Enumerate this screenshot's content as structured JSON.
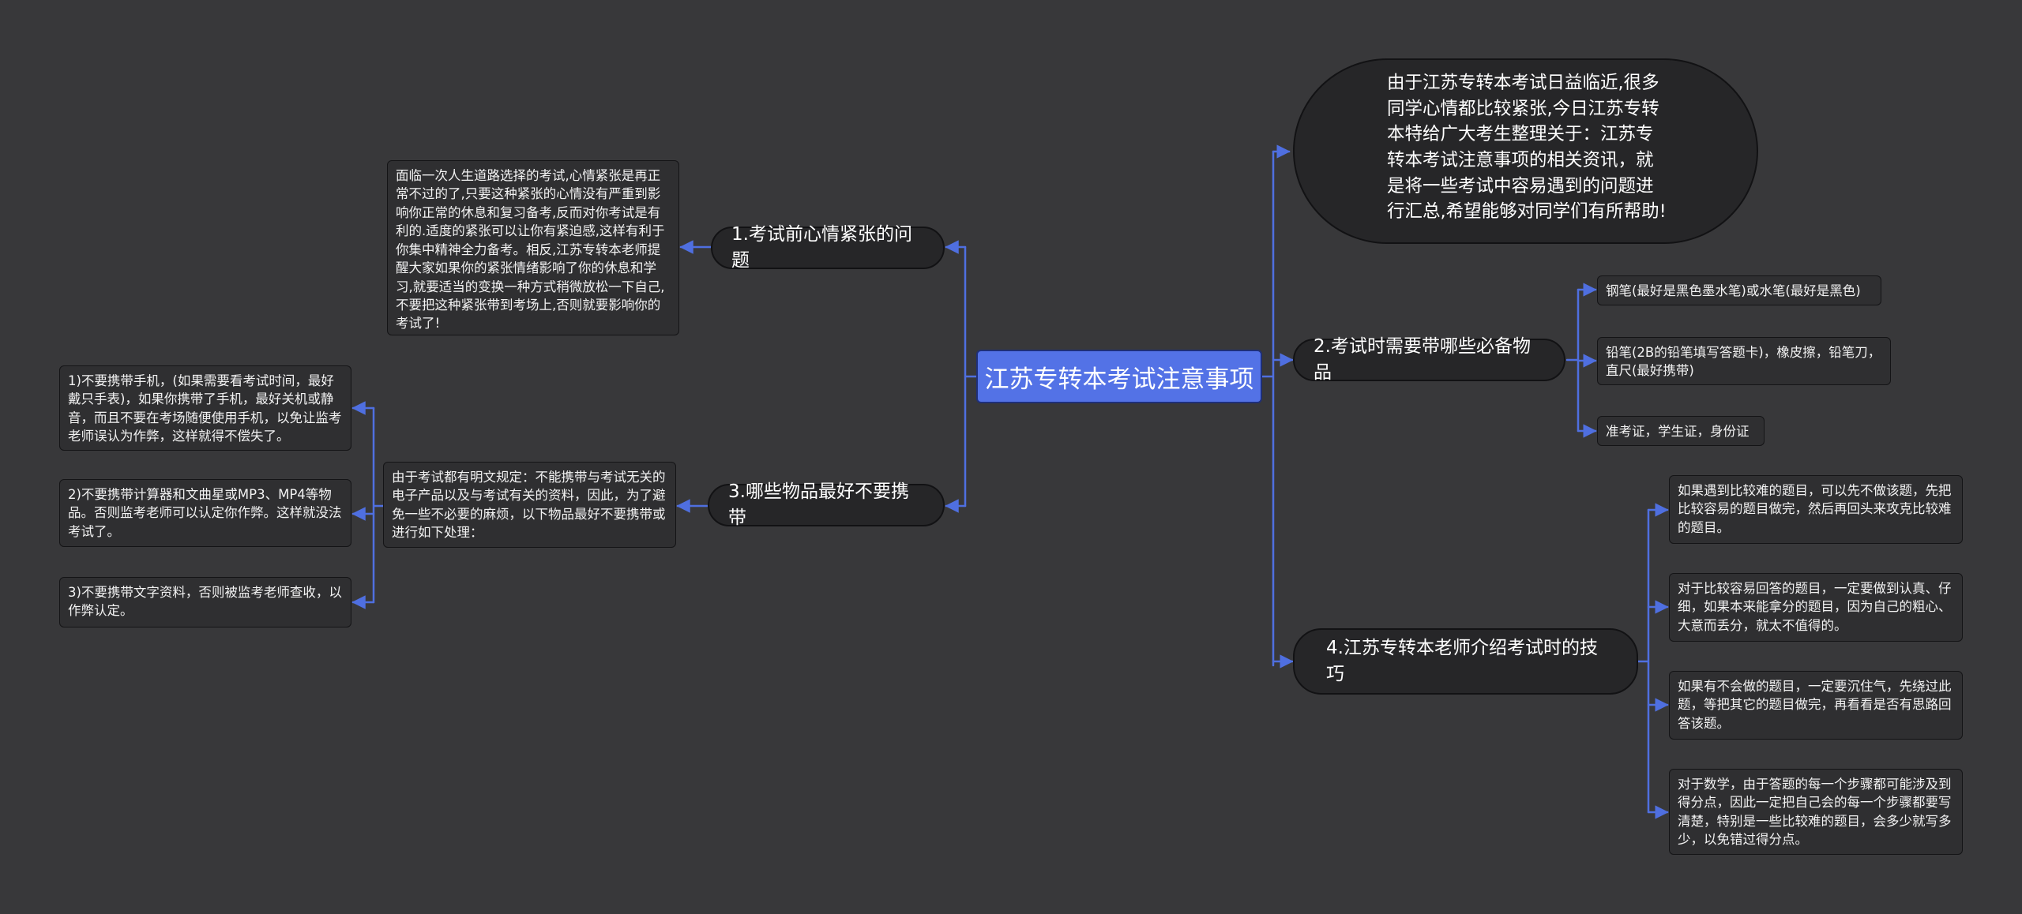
{
  "root": {
    "label": "江苏专转本考试注意事项"
  },
  "intro": {
    "text": "由于江苏专转本考试日益临近,很多同学心情都比较紧张,今日江苏专转本特给广大考生整理关于：江苏专转本考试注意事项的相关资讯，就是将一些考试中容易遇到的问题进行汇总,希望能够对同学们有所帮助!"
  },
  "branch1": {
    "label": "1.考试前心情紧张的问题",
    "note": "面临一次人生道路选择的考试,心情紧张是再正常不过的了,只要这种紧张的心情没有严重到影响你正常的休息和复习备考,反而对你考试是有利的.适度的紧张可以让你有紧迫感,这样有利于你集中精神全力备考。相反,江苏专转本老师提醒大家如果你的紧张情绪影响了你的休息和学习,就要适当的变换一种方式稍微放松一下自己,不要把这种紧张带到考场上,否则就要影响你的考试了!"
  },
  "branch2": {
    "label": "2.考试时需要带哪些必备物品",
    "items": [
      "钢笔(最好是黑色墨水笔)或水笔(最好是黑色)",
      "铅笔(2B的铅笔填写答题卡)，橡皮擦，铅笔刀，直尺(最好携带)",
      "准考证，学生证，身份证"
    ]
  },
  "branch3": {
    "label": "3.哪些物品最好不要携带",
    "note": "由于考试都有明文规定：不能携带与考试无关的电子产品以及与考试有关的资料，因此，为了避免一些不必要的麻烦，以下物品最好不要携带或进行如下处理：",
    "items": [
      "1)不要携带手机，(如果需要看考试时间，最好戴只手表)，如果你携带了手机，最好关机或静音，而且不要在考场随便使用手机，以免让监考老师误认为作弊，这样就得不偿失了。",
      "2)不要携带计算器和文曲星或MP3、MP4等物品。否则监考老师可以认定你作弊。这样就没法考试了。",
      "3)不要携带文字资料，否则被监考老师查收，以作弊认定。"
    ]
  },
  "branch4": {
    "label": "4.江苏专转本老师介绍考试时的技巧",
    "items": [
      "如果遇到比较难的题目，可以先不做该题，先把比较容易的题目做完，然后再回头来攻克比较难的题目。",
      "对于比较容易回答的题目，一定要做到认真、仔细，如果本来能拿分的题目，因为自己的粗心、大意而丢分，就太不值得的。",
      "如果有不会做的题目，一定要沉住气，先绕过此题，等把其它的题目做完，再看看是否有思路回答该题。",
      "对于数学，由于答题的每一个步骤都可能涉及到得分点，因此一定把自己会的每一个步骤都要写清楚，特别是一些比较难的题目，会多少就写多少，以免错过得分点。"
    ]
  },
  "colors": {
    "background": "#38383a",
    "connector": "#4f6fe0",
    "root": "#5372e6"
  }
}
